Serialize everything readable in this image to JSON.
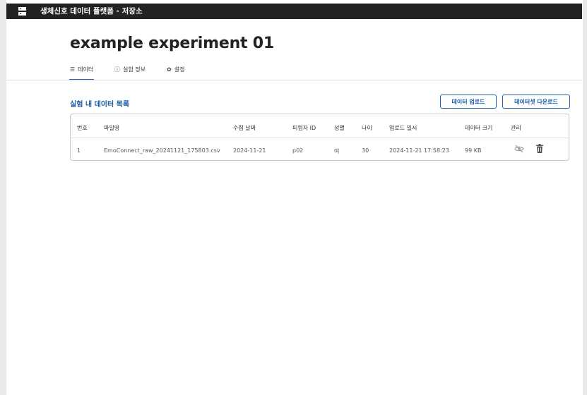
{
  "app": {
    "title": "생체신호 데이터 플랫폼 - 저장소",
    "icon": "server-icon"
  },
  "experiment": {
    "title": "example experiment 01"
  },
  "tabs": [
    {
      "label": "데이터",
      "icon": "list-icon",
      "active": true
    },
    {
      "label": "실험 정보",
      "icon": "info-icon",
      "active": false
    },
    {
      "label": "설정",
      "icon": "gear-icon",
      "active": false
    }
  ],
  "section": {
    "title": "실험 내 데이터 목록",
    "upload_label": "데이터 업로드",
    "download_label": "데이터셋 다운로드"
  },
  "table": {
    "columns": [
      "번호",
      "파일명",
      "수집 날짜",
      "피험자 ID",
      "성별",
      "나이",
      "업로드 일시",
      "데이터 크기",
      "관리"
    ],
    "rows": [
      {
        "no": "1",
        "filename": "EmoConnect_raw_20241121_175803.csv",
        "date": "2024-11-21",
        "subject": "p02",
        "gender": "여",
        "age": "30",
        "uploaded": "2024-11-21 17:58:23",
        "size": "99 KB",
        "actions": [
          "eye-off-icon",
          "trash-icon"
        ]
      }
    ]
  },
  "colors": {
    "accent": "#1f5fa8",
    "topbar": "#222222"
  }
}
